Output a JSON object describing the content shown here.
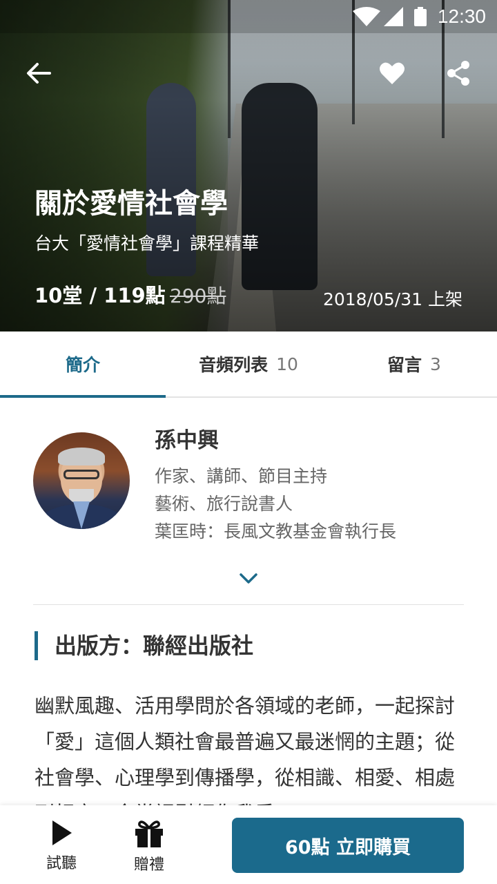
{
  "status_bar": {
    "time": "12:30"
  },
  "course": {
    "title": "關於愛情社會學",
    "subtitle": "台大「愛情社會學」課程精華",
    "price_text": "10堂 / 119點",
    "original_price": "290點",
    "release_date": "2018/05/31 上架"
  },
  "tabs": [
    {
      "label": "簡介",
      "count": ""
    },
    {
      "label": "音頻列表",
      "count": "10"
    },
    {
      "label": "留言",
      "count": "3"
    }
  ],
  "author": {
    "name": "孫中興",
    "lines": [
      "作家、講師、節目主持",
      "藝術、旅行說書人",
      "葉匡時：長風文教基金會執行長"
    ]
  },
  "publisher": "出版方：聯經出版社",
  "description": "幽默風趣、活用學問於各領域的老師，一起探討「愛」這個人類社會最普遍又最迷惘的主題；從社會學、心理學到傳播學，從相識、相愛、相處到相守，全堂課引領你我重",
  "bottom_bar": {
    "trial_label": "試聽",
    "gift_label": "贈禮",
    "buy_label": "60點 立即購買"
  },
  "colors": {
    "accent": "#1d6a8a",
    "buy_button": "#1b6a8c"
  }
}
